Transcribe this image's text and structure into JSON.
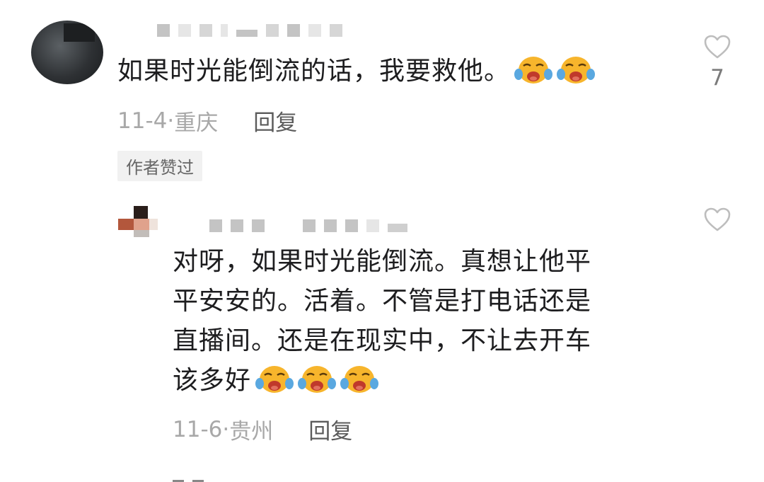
{
  "comments": [
    {
      "text": "如果时光能倒流的话，我要救他。",
      "emoji_count": 2,
      "emoji": "crying-face",
      "date": "11-4",
      "location": "重庆",
      "reply_label": "回复",
      "badge": "作者赞过",
      "likes": "7"
    },
    {
      "text_lines": [
        "对呀，如果时光能倒流。真想让他平",
        "平安安的。活着。不管是打电话还是",
        "直播间。还是在现实中，不让去开车",
        "该多好"
      ],
      "emoji_count": 3,
      "emoji": "crying-face",
      "date": "11-6",
      "location": "贵州",
      "reply_label": "回复"
    }
  ],
  "icons": {
    "like": "heart-outline-icon",
    "emoji": "crying-face-emoji"
  },
  "colors": {
    "text": "#1d1d1f",
    "meta": "#a8a8a8",
    "reply": "#5b5b5b",
    "badge_bg": "#f1f1f1",
    "heart": "#bdbdbd",
    "emoji_face": "#f7b52c",
    "emoji_tears": "#5aa8e0"
  }
}
